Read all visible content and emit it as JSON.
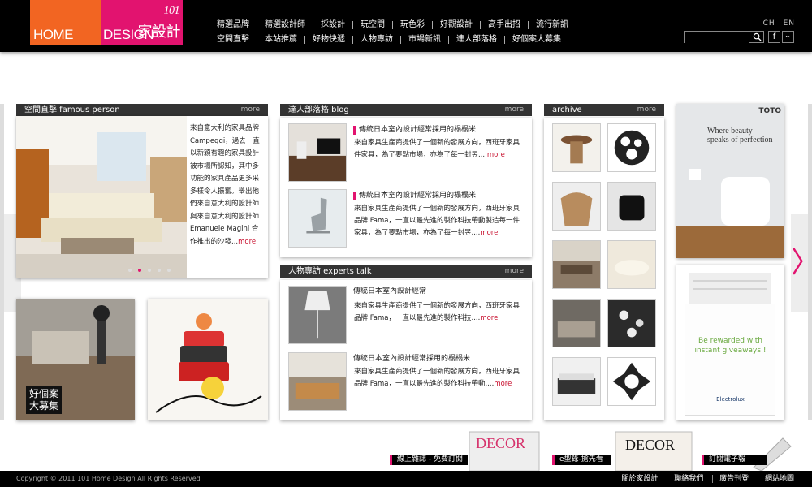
{
  "logo": {
    "home": "HOME",
    "design": "DESIGN",
    "num": "101",
    "chinese": "家設計"
  },
  "nav": {
    "row1": [
      "精選品牌",
      "精選設計師",
      "採設計",
      "玩空間",
      "玩色彩",
      "好觀設計",
      "高手出招",
      "流行新訊"
    ],
    "row2": [
      "空間直擊",
      "本站推薦",
      "好物快遞",
      "人物專訪",
      "市場新訊",
      "達人部落格",
      "好個案大募集"
    ]
  },
  "lang": {
    "ch": "CH",
    "en": "EN"
  },
  "search": {
    "placeholder": ""
  },
  "colors": {
    "orange": "#f26522",
    "magenta": "#e2136f",
    "dark": "#333333"
  },
  "famous": {
    "header": "空間直擊 famous person",
    "more": "more",
    "text": "來自意大利的家具品牌 Campeggi，過去一直以新穎有趣的家具設計被市場所認知，其中多功能的家具產品更多采多樣令人振奮。舉出他們來自意大利的設計師與來自意大利的設計師 Emanuele Magini 合作推出的沙發...",
    "more_inline": "more",
    "dots": 5,
    "active_dot": 2
  },
  "promo_case": {
    "line1": "好個案",
    "line2": "大募集"
  },
  "blog": {
    "header": "達人部落格 blog",
    "more": "more",
    "items": [
      {
        "title": "傳統日本室內設計經常採用的榻榻米",
        "text": "來自家具生產商提供了一個新的發展方向，西班牙家具件家具，為了要點市場，亦為了每一封昱....",
        "more": "more"
      },
      {
        "title": "傳統日本室內設計經常採用的榻榻米",
        "text": "來自家具生產商提供了一個新的發展方向，西班牙家具品牌 Fama，一直以最先進的製作科技帶動製造每一件家具，為了要點市場，亦為了每一封昱....",
        "more": "more"
      }
    ]
  },
  "talk": {
    "header": "人物專訪 experts talk",
    "more": "more",
    "items": [
      {
        "title": "傳統日本室內設計經常",
        "text": "來自家具生產商提供了一個新的發展方向，西班牙家具品牌 Fama，一直以最先進的製作科技....",
        "more": "more"
      },
      {
        "title": "傳統日本室內設計經常採用的榻榻米",
        "text": "來自家具生產商提供了一個新的發展方向，西班牙家具品牌 Fama，一直以最先進的製作科技帶動....",
        "more": "more"
      }
    ]
  },
  "archive": {
    "header": "archive",
    "more": "more"
  },
  "ad_toto": {
    "brand": "TOTO",
    "line1": "Where beauty",
    "line2": "speaks of perfection"
  },
  "ad_electrolux": {
    "line1": "Be rewarded with",
    "line2": "instant giveaways !",
    "brand": "Electrolux"
  },
  "promos": [
    "線上雜誌 - 免費訂閱",
    "e型錄-搶先看",
    "訂閱電子報"
  ],
  "magazine": "DECOR",
  "footer": {
    "copyright": "Copyright © 2011   101 Home Design All Rights Reserved",
    "links": [
      "關於家設計",
      "聯絡我們",
      "廣告刊登",
      "網站地圖"
    ]
  }
}
